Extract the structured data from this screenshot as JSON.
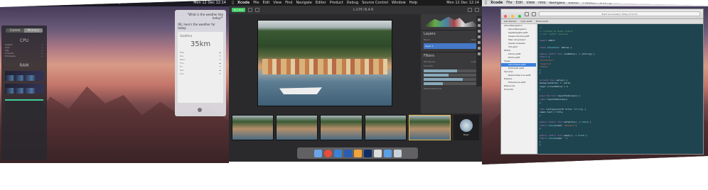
{
  "left": {
    "menubar": {
      "apple": "",
      "app": "Safari",
      "items": [
        "File",
        "Edit",
        "View",
        "History",
        "Bookmarks",
        "Window",
        "Help"
      ],
      "clock": "Mon 12 Dec 12:14"
    },
    "activity": {
      "tabs": [
        "Control",
        "Memory"
      ],
      "cpu_header": "CPU",
      "ram_header": "RAM",
      "rows": [
        "System",
        "User",
        "Idle",
        "Threads",
        "Processes"
      ]
    },
    "siri": {
      "question": "\"What is the weather like today?\"",
      "answer": "OK, here's the weather for today:",
      "city": "Gaiafera",
      "temp": "35km",
      "days": [
        "Mon",
        "Tue",
        "Wed",
        "Thu",
        "Fri",
        "Sat",
        "Sun"
      ]
    }
  },
  "center": {
    "menubar": {
      "app": "Xcode",
      "items": [
        "File",
        "Edit",
        "View",
        "Find",
        "Navigate",
        "Editor",
        "Product",
        "Debug",
        "Source Control",
        "Window",
        "Help"
      ],
      "clock": "Mon 12 Dec 12:14"
    },
    "toolbar": {
      "button": "Buy Now",
      "logo": "LUMINAR"
    },
    "side": {
      "layers_h": "Layers",
      "blend": "Blend",
      "opacity": "Opacity",
      "layer": "Layer 1",
      "filters_h": "Filters",
      "workspace": "Workspace",
      "custom": "Custom",
      "filter1": "Dramatic",
      "filter2": "Details Enhancer"
    },
    "presets_label": "Basic"
  },
  "right": {
    "menubar": {
      "app": "Xcode",
      "items": [
        "File",
        "Edit",
        "View",
        "Find",
        "Navigate",
        "Editor",
        "Product",
        "Debug",
        "Source Control",
        "Window",
        "Help"
      ],
      "clock": "Mon 12 Dec 12:14"
    },
    "status": "Build Succeeded | Today at 12:14",
    "tabs": [
      "Get Started",
      "main.swift",
      "Model.swift"
    ],
    "nav_items": [
      {
        "label": "AlbumNavigation",
        "sub": false,
        "sel": false
      },
      {
        "label": "AlbumNavigation",
        "sub": true,
        "sel": false
      },
      {
        "label": "AppDelegate.swift",
        "sub": true,
        "sel": false
      },
      {
        "label": "ViewController.swift",
        "sub": true,
        "sel": false
      },
      {
        "label": "Main.storyboard",
        "sub": true,
        "sel": false
      },
      {
        "label": "Assets.xcassets",
        "sub": true,
        "sel": false
      },
      {
        "label": "Info.plist",
        "sub": true,
        "sel": false
      },
      {
        "label": "Model",
        "sub": false,
        "sel": false
      },
      {
        "label": "Album.swift",
        "sub": true,
        "sel": false
      },
      {
        "label": "Photo.swift",
        "sub": true,
        "sel": false
      },
      {
        "label": "Views",
        "sub": false,
        "sel": false
      },
      {
        "label": "AlbumView.swift",
        "sub": true,
        "sel": true
      },
      {
        "label": "PhotoCell.swift",
        "sub": true,
        "sel": false
      },
      {
        "label": "Services",
        "sub": false,
        "sel": false
      },
      {
        "label": "NetworkService.swift",
        "sub": true,
        "sel": false
      },
      {
        "label": "Helpers",
        "sub": false,
        "sel": false
      },
      {
        "label": "Extensions.swift",
        "sub": true,
        "sel": false
      },
      {
        "label": "Resources",
        "sub": false,
        "sel": false
      },
      {
        "label": "Products",
        "sub": false,
        "sel": false
      }
    ],
    "code": [
      [
        {
          "c": "cm",
          "t": "//"
        }
      ],
      [
        {
          "c": "cm",
          "t": "//  Created by Robin Schulz"
        }
      ],
      [
        {
          "c": "cm",
          "t": "//  All rights reserved."
        }
      ],
      [
        {
          "c": "tx",
          "t": ""
        }
      ],
      [
        {
          "c": "kw",
          "t": "import "
        },
        {
          "c": "tx",
          "t": "UIKit"
        }
      ],
      [
        {
          "c": "tx",
          "t": ""
        }
      ],
      [
        {
          "c": "kw",
          "t": "class "
        },
        {
          "c": "ty",
          "t": "AlbumView"
        },
        {
          "c": "tx",
          "t": ": UIView {"
        }
      ],
      [
        {
          "c": "tx",
          "t": ""
        }
      ],
      [
        {
          "c": "kw",
          "t": "  public static func "
        },
        {
          "c": "tx",
          "t": "loadData() -> [String] {"
        }
      ],
      [
        {
          "c": "kw",
          "t": "    return "
        },
        {
          "c": "tx",
          "t": "["
        }
      ],
      [
        {
          "c": "str",
          "t": "      \"Portofino\","
        }
      ],
      [
        {
          "c": "str",
          "t": "      \"Liguria\","
        }
      ],
      [
        {
          "c": "str",
          "t": "      \"Italy\""
        }
      ],
      [
        {
          "c": "tx",
          "t": "    ]"
        }
      ],
      [
        {
          "c": "tx",
          "t": "  }"
        }
      ],
      [
        {
          "c": "tx",
          "t": ""
        }
      ],
      [
        {
          "c": "kw",
          "t": "  private func "
        },
        {
          "c": "tx",
          "t": "setup() {"
        }
      ],
      [
        {
          "c": "tx",
          "t": "    backgroundColor = .white"
        }
      ],
      [
        {
          "c": "tx",
          "t": "    layer.cornerRadius = 4"
        }
      ],
      [
        {
          "c": "tx",
          "t": "  }"
        }
      ],
      [
        {
          "c": "tx",
          "t": ""
        }
      ],
      [
        {
          "c": "kw",
          "t": "  override func "
        },
        {
          "c": "tx",
          "t": "layoutSubviews() {"
        }
      ],
      [
        {
          "c": "kw",
          "t": "    super"
        },
        {
          "c": "tx",
          "t": ".layoutSubviews()"
        }
      ],
      [
        {
          "c": "tx",
          "t": "  }"
        }
      ],
      [
        {
          "c": "tx",
          "t": ""
        }
      ],
      [
        {
          "c": "kw",
          "t": "  func "
        },
        {
          "c": "tx",
          "t": "configure(with title: "
        },
        {
          "c": "ty",
          "t": "String"
        },
        {
          "c": "tx",
          "t": ") {"
        }
      ],
      [
        {
          "c": "tx",
          "t": "    label.text = title"
        }
      ],
      [
        {
          "c": "tx",
          "t": "  }"
        }
      ],
      [
        {
          "c": "tx",
          "t": ""
        }
      ],
      [
        {
          "c": "kw",
          "t": "  public static func "
        },
        {
          "c": "tx",
          "t": "defaults() -> "
        },
        {
          "c": "ty",
          "t": "Album"
        },
        {
          "c": "tx",
          "t": " {"
        }
      ],
      [
        {
          "c": "kw",
          "t": "    return "
        },
        {
          "c": "ty",
          "t": "Album"
        },
        {
          "c": "tx",
          "t": "(name: "
        },
        {
          "c": "str",
          "t": "\"Default\""
        },
        {
          "c": "tx",
          "t": ")"
        }
      ],
      [
        {
          "c": "tx",
          "t": "  }"
        }
      ],
      [
        {
          "c": "tx",
          "t": ""
        }
      ],
      [
        {
          "c": "kw",
          "t": "  public static func "
        },
        {
          "c": "tx",
          "t": "empty() -> "
        },
        {
          "c": "ty",
          "t": "Album"
        },
        {
          "c": "tx",
          "t": " {"
        }
      ],
      [
        {
          "c": "kw",
          "t": "    return "
        },
        {
          "c": "ty",
          "t": "Album"
        },
        {
          "c": "tx",
          "t": "(name: "
        },
        {
          "c": "str",
          "t": "\"\""
        },
        {
          "c": "tx",
          "t": ")"
        }
      ],
      [
        {
          "c": "tx",
          "t": "  }"
        }
      ],
      [
        {
          "c": "tx",
          "t": "}"
        }
      ]
    ]
  },
  "colors": {
    "accent": "#4479c7",
    "buy": "#44cc66",
    "editor_bg": "#1e4450",
    "selection": "#3d80dc"
  }
}
